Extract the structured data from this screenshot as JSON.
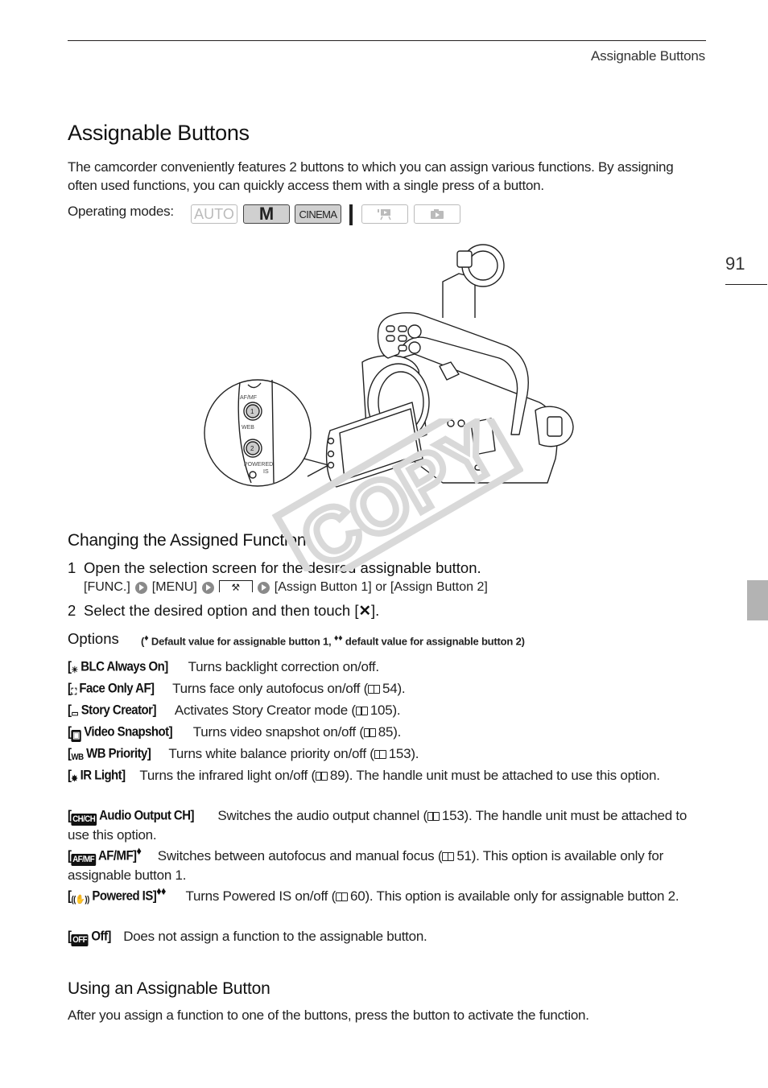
{
  "header": {
    "running_head": "Assignable Buttons",
    "page_number": "91"
  },
  "title": "Assignable Buttons",
  "intro": "The camcorder conveniently features 2 buttons to which you can assign various functions. By assigning often used functions, you can quickly access them with a single press of a button.",
  "operating_modes": {
    "label": "Operating modes:",
    "modes": [
      {
        "label": "AUTO",
        "state": "inactive"
      },
      {
        "label": "M",
        "state": "active"
      },
      {
        "label": "CINEMA",
        "state": "active"
      },
      {
        "label": "video-playback-icon",
        "state": "inactive"
      },
      {
        "label": "photo-playback-icon",
        "state": "inactive"
      }
    ]
  },
  "illustration": {
    "callout_labels": [
      "AF/MF",
      "1",
      "WEB",
      "2",
      "POWERED",
      "IS"
    ]
  },
  "changing": {
    "heading": "Changing the Assigned Function",
    "step1_num": "1",
    "step1": "Open the selection screen for the desired assignable button.",
    "path": [
      "[FUNC.]",
      "[MENU]",
      "[Assign Button 1] or [Assign Button 2]"
    ],
    "step2_num": "2",
    "step2_pre": "Select the desired option and then touch [",
    "step2_icon": "✕",
    "step2_post": "]."
  },
  "options": {
    "heading": "Options",
    "note_pre": "(",
    "note_mark1": "♦",
    "note_1": " Default value for assignable button 1, ",
    "note_mark2": "♦♦",
    "note_2": " default value for assignable button 2)",
    "items": [
      {
        "icon": "☀",
        "name": "BLC Always On]",
        "mark": "",
        "desc": "Turns backlight correction on/off.",
        "ref": "",
        "tail": ""
      },
      {
        "icon": "⛶",
        "name": "Face Only AF]",
        "mark": "",
        "desc": "Turns face only autofocus on/off (",
        "ref": "54",
        "tail": ")."
      },
      {
        "icon": "▭",
        "name": "Story Creator]",
        "mark": "",
        "desc": "Activates Story Creator mode (",
        "ref": "105",
        "tail": ")."
      },
      {
        "icon": "▣",
        "name": "Video Snapshot]",
        "mark": "",
        "desc": "Turns video snapshot on/off (",
        "ref": "85",
        "tail": ")."
      },
      {
        "icon": "WB",
        "name": "WB Priority]",
        "mark": "",
        "desc": "Turns white balance priority on/off (",
        "ref": "153",
        "tail": ")."
      },
      {
        "icon": "✸",
        "name": "IR Light]",
        "mark": "",
        "desc": "Turns the infrared light on/off (",
        "ref": "89",
        "tail": "). The handle unit must be attached to use this option."
      },
      {
        "icon": "CH/CH",
        "name": "Audio Output CH]",
        "mark": "",
        "desc": "Switches the audio output channel (",
        "ref": "153",
        "tail": "). The handle unit must be attached to use this option."
      },
      {
        "icon": "AF/MF",
        "name": "AF/MF]",
        "mark": "♦",
        "desc": "Switches between autofocus and manual focus (",
        "ref": "51",
        "tail": "). This option is available only for assignable button 1."
      },
      {
        "icon": "((✋))",
        "name": "Powered IS]",
        "mark": "♦♦",
        "desc": "Turns Powered IS on/off (",
        "ref": "60",
        "tail": "). This option is available only for assignable button 2."
      },
      {
        "icon": "OFF",
        "name": "Off]",
        "mark": "",
        "desc": "Does not assign a function to the assignable button.",
        "ref": "",
        "tail": ""
      }
    ]
  },
  "using": {
    "heading": "Using an Assignable Button",
    "text": "After you assign a function to one of the buttons, press the button to activate the function."
  },
  "watermark": "COPY"
}
